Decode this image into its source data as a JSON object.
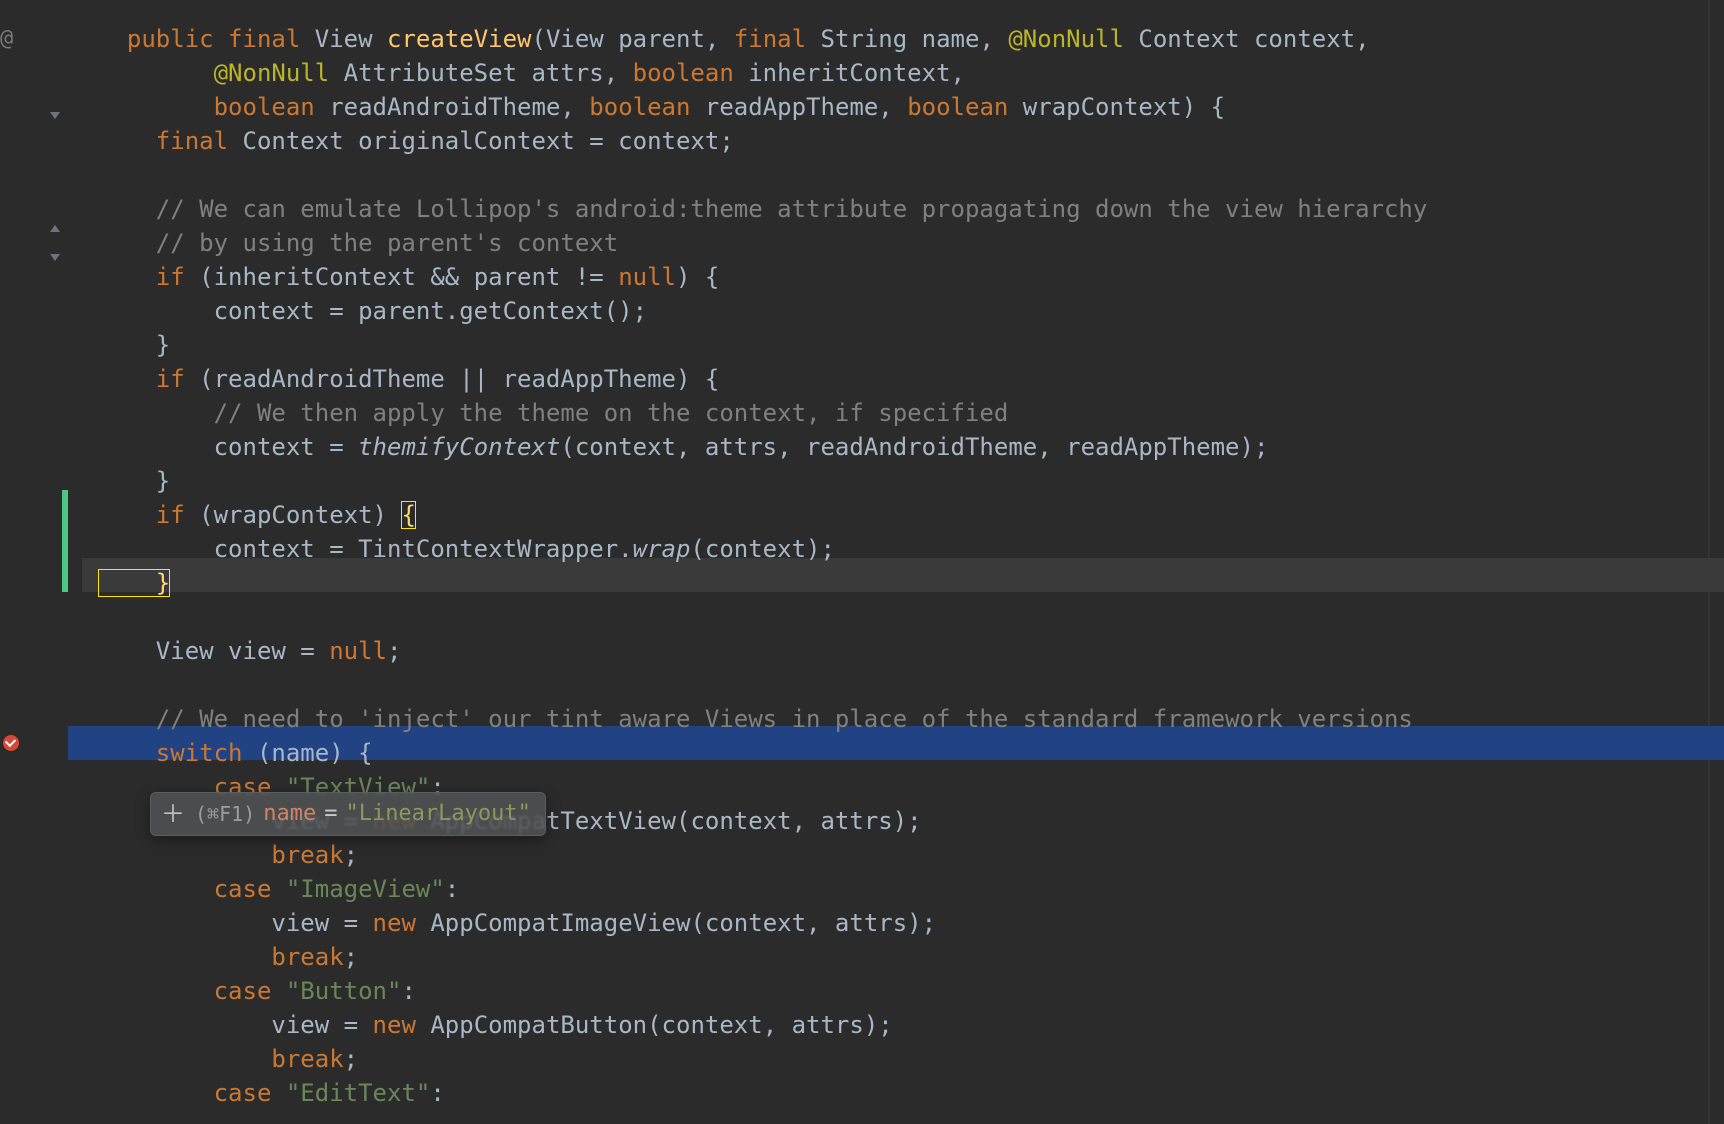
{
  "colors": {
    "keyword": "#cc7832",
    "method": "#ffc66d",
    "comment": "#808080",
    "string": "#6a8759",
    "annotation": "#bbb529",
    "highlight": "#214283",
    "null": "#cc7832"
  },
  "gutter": {
    "override_marker": "@",
    "breakpoint_line_index": 20
  },
  "debug_tooltip": {
    "shortcut": "(⌘F1)",
    "variable": "name",
    "equals": "=",
    "value": "\"LinearLayout\""
  },
  "lines": [
    {
      "tokens": [
        {
          "pad": 2,
          "css": "kw",
          "text": "public"
        },
        {
          "text": " "
        },
        {
          "css": "kw",
          "text": "final"
        },
        {
          "text": " View "
        },
        {
          "css": "mth",
          "text": "createView"
        },
        {
          "text": "(View parent, "
        },
        {
          "css": "kw",
          "text": "final"
        },
        {
          "text": " String name, "
        },
        {
          "css": "ann",
          "text": "@NonNull"
        },
        {
          "text": " Context context,"
        }
      ]
    },
    {
      "tokens": [
        {
          "pad": 8,
          "css": "ann",
          "text": "@NonNull"
        },
        {
          "text": " AttributeSet attrs, "
        },
        {
          "css": "kw",
          "text": "boolean"
        },
        {
          "text": " inheritContext,"
        }
      ]
    },
    {
      "tokens": [
        {
          "pad": 8,
          "css": "kw",
          "text": "boolean"
        },
        {
          "text": " readAndroidTheme, "
        },
        {
          "css": "kw",
          "text": "boolean"
        },
        {
          "text": " readAppTheme, "
        },
        {
          "css": "kw",
          "text": "boolean"
        },
        {
          "text": " wrapContext) {"
        }
      ]
    },
    {
      "tokens": [
        {
          "pad": 4,
          "css": "kw",
          "text": "final"
        },
        {
          "text": " Context originalContext = context;"
        }
      ]
    },
    {
      "tokens": [
        {
          "pad": 0,
          "text": ""
        }
      ]
    },
    {
      "tokens": [
        {
          "pad": 4,
          "css": "cm",
          "text": "// We can emulate Lollipop's android:theme attribute propagating down the view hierarchy"
        }
      ]
    },
    {
      "tokens": [
        {
          "pad": 4,
          "css": "cm",
          "text": "// by using the parent's context"
        }
      ]
    },
    {
      "tokens": [
        {
          "pad": 4,
          "css": "kw",
          "text": "if"
        },
        {
          "text": " (inheritContext && parent != "
        },
        {
          "css": "kw",
          "text": "null"
        },
        {
          "text": ") {"
        }
      ]
    },
    {
      "tokens": [
        {
          "pad": 8,
          "text": "context = parent.getContext();"
        }
      ]
    },
    {
      "tokens": [
        {
          "pad": 4,
          "text": "}"
        }
      ]
    },
    {
      "tokens": [
        {
          "pad": 4,
          "css": "kw",
          "text": "if"
        },
        {
          "text": " (readAndroidTheme || readAppTheme) {"
        }
      ]
    },
    {
      "tokens": [
        {
          "pad": 8,
          "css": "cm",
          "text": "// We then apply the theme on the context, if specified"
        }
      ]
    },
    {
      "tokens": [
        {
          "pad": 8,
          "text": "context = "
        },
        {
          "css": "it",
          "text": "themifyContext"
        },
        {
          "text": "(context, attrs, readAndroidTheme, readAppTheme);"
        }
      ]
    },
    {
      "tokens": [
        {
          "pad": 4,
          "text": "}"
        }
      ]
    },
    {
      "tokens": [
        {
          "pad": 4,
          "css": "kw",
          "text": "if"
        },
        {
          "text": " (wrapContext) "
        },
        {
          "css": "brack-hl",
          "text": "{"
        }
      ]
    },
    {
      "tokens": [
        {
          "pad": 8,
          "text": "context = TintContextWrapper."
        },
        {
          "css": "it",
          "text": "wrap"
        },
        {
          "text": "(context);"
        }
      ]
    },
    {
      "tokens": [
        {
          "pad": 4,
          "css": "brack-hl",
          "text": "}"
        }
      ],
      "current": true
    },
    {
      "tokens": [
        {
          "pad": 0,
          "text": ""
        }
      ]
    },
    {
      "tokens": [
        {
          "pad": 4,
          "text": "View view = "
        },
        {
          "css": "kw",
          "text": "null"
        },
        {
          "text": ";"
        }
      ]
    },
    {
      "tokens": [
        {
          "pad": 0,
          "text": ""
        }
      ]
    },
    {
      "tokens": [
        {
          "pad": 4,
          "css": "cm",
          "text": "// We need to 'inject' our tint aware Views in place of the standard framework versions"
        }
      ]
    },
    {
      "tokens": [
        {
          "pad": 4,
          "css": "kw",
          "text": "switch"
        },
        {
          "text": " (name) {"
        }
      ],
      "selection": true
    },
    {
      "tokens": [
        {
          "pad": 8,
          "css": "kw",
          "text": "case"
        },
        {
          "text": " "
        },
        {
          "css": "str",
          "text": "\"TextView\""
        },
        {
          "text": ":"
        }
      ]
    },
    {
      "tokens": [
        {
          "pad": 12,
          "text": "view = "
        },
        {
          "css": "kw",
          "text": "new"
        },
        {
          "text": " AppCompatTextView(context, attrs);"
        }
      ]
    },
    {
      "tokens": [
        {
          "pad": 12,
          "css": "kw",
          "text": "break"
        },
        {
          "text": ";"
        }
      ]
    },
    {
      "tokens": [
        {
          "pad": 8,
          "css": "kw",
          "text": "case"
        },
        {
          "text": " "
        },
        {
          "css": "str",
          "text": "\"ImageView\""
        },
        {
          "text": ":"
        }
      ]
    },
    {
      "tokens": [
        {
          "pad": 12,
          "text": "view = "
        },
        {
          "css": "kw",
          "text": "new"
        },
        {
          "text": " AppCompatImageView(context, attrs);"
        }
      ]
    },
    {
      "tokens": [
        {
          "pad": 12,
          "css": "kw",
          "text": "break"
        },
        {
          "text": ";"
        }
      ]
    },
    {
      "tokens": [
        {
          "pad": 8,
          "css": "kw",
          "text": "case"
        },
        {
          "text": " "
        },
        {
          "css": "str",
          "text": "\"Button\""
        },
        {
          "text": ":"
        }
      ]
    },
    {
      "tokens": [
        {
          "pad": 12,
          "text": "view = "
        },
        {
          "css": "kw",
          "text": "new"
        },
        {
          "text": " AppCompatButton(context, attrs);"
        }
      ]
    },
    {
      "tokens": [
        {
          "pad": 12,
          "css": "kw",
          "text": "break"
        },
        {
          "text": ";"
        }
      ]
    },
    {
      "tokens": [
        {
          "pad": 8,
          "css": "kw",
          "text": "case"
        },
        {
          "text": " "
        },
        {
          "css": "str",
          "text": "\"EditText\""
        },
        {
          "text": ":"
        }
      ]
    }
  ]
}
